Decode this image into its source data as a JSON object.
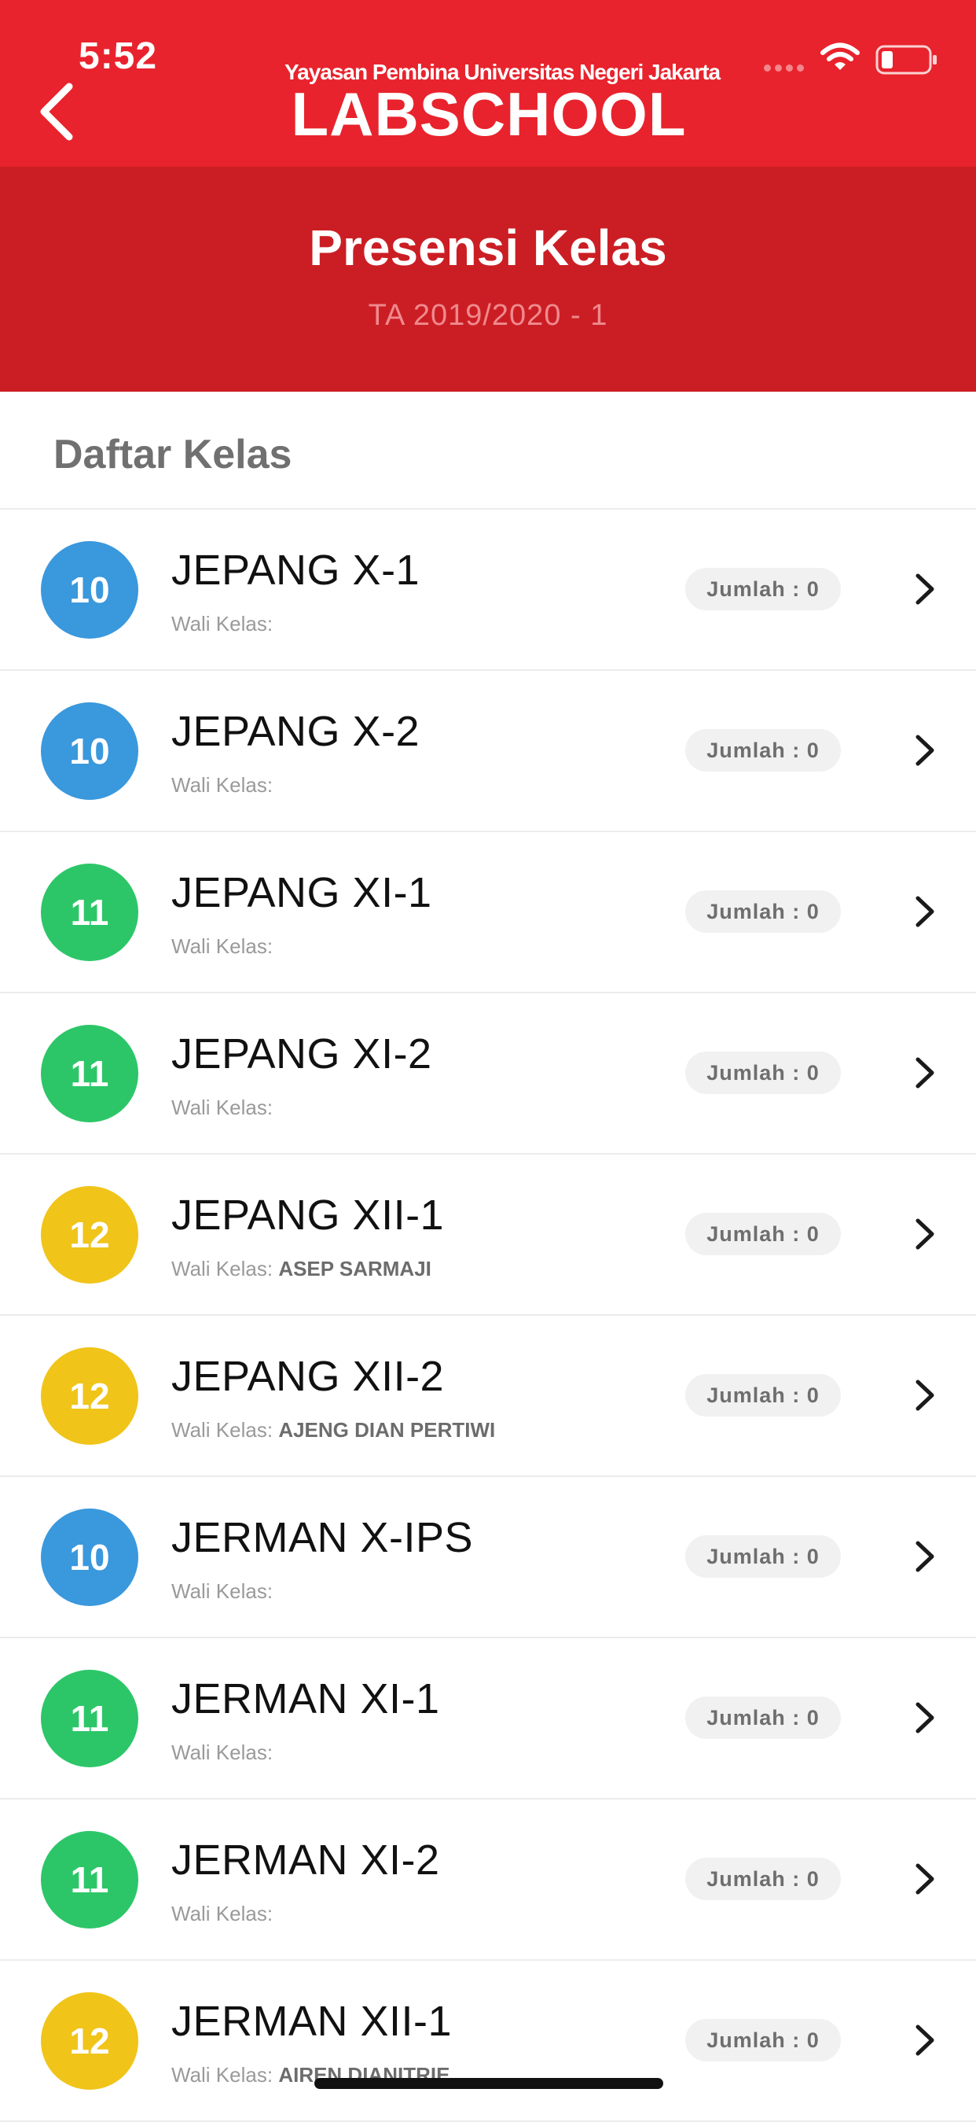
{
  "status": {
    "time": "5:52"
  },
  "brand": {
    "subtitle": "Yayasan Pembina Universitas Negeri Jakarta",
    "name": "LABSCHOOL"
  },
  "page": {
    "title": "Presensi Kelas",
    "subtitle": "TA 2019/2020 - 1"
  },
  "section": {
    "title": "Daftar Kelas"
  },
  "wali_prefix": "Wali Kelas:",
  "classes": [
    {
      "grade": "10",
      "name": "JEPANG X-1",
      "wali": "",
      "count": "Jumlah : 0"
    },
    {
      "grade": "10",
      "name": "JEPANG X-2",
      "wali": "",
      "count": "Jumlah : 0"
    },
    {
      "grade": "11",
      "name": "JEPANG XI-1",
      "wali": "",
      "count": "Jumlah : 0"
    },
    {
      "grade": "11",
      "name": "JEPANG XI-2",
      "wali": "",
      "count": "Jumlah : 0"
    },
    {
      "grade": "12",
      "name": "JEPANG XII-1",
      "wali": "ASEP SARMAJI",
      "count": "Jumlah : 0"
    },
    {
      "grade": "12",
      "name": "JEPANG XII-2",
      "wali": "AJENG DIAN PERTIWI",
      "count": "Jumlah : 0"
    },
    {
      "grade": "10",
      "name": "JERMAN X-IPS",
      "wali": "",
      "count": "Jumlah : 0"
    },
    {
      "grade": "11",
      "name": "JERMAN XI-1",
      "wali": "",
      "count": "Jumlah : 0"
    },
    {
      "grade": "11",
      "name": "JERMAN XI-2",
      "wali": "",
      "count": "Jumlah : 0"
    },
    {
      "grade": "12",
      "name": "JERMAN XII-1",
      "wali": "AIREN DIANITRIE",
      "count": "Jumlah : 0"
    }
  ],
  "colors": {
    "header": "#e8232d",
    "banner": "#cb1e24",
    "grade_10": "#3a98dd",
    "grade_11": "#2cc668",
    "grade_12": "#f0c419"
  },
  "icons": {
    "back": "chevron-left-icon",
    "row_action": "chevron-right-icon",
    "wifi": "wifi-icon",
    "battery": "battery-icon"
  }
}
